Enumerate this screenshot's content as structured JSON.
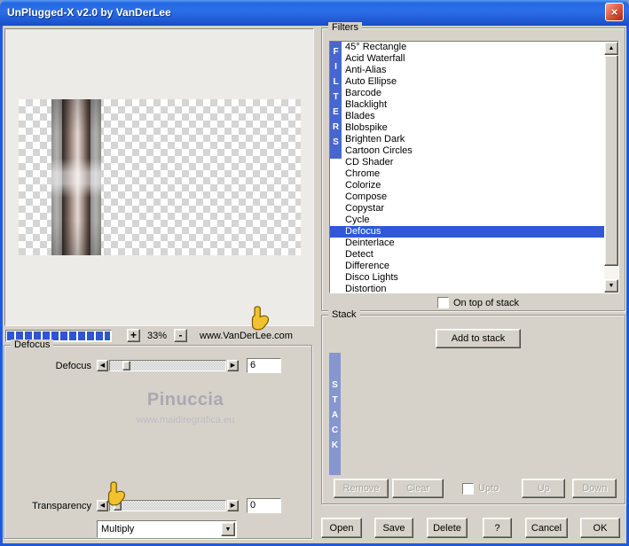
{
  "window": {
    "title": "UnPlugged-X v2.0 by VanDerLee"
  },
  "icons": {
    "close": "×",
    "arrow_up": "▲",
    "arrow_down": "▼",
    "arrow_left": "◀",
    "arrow_right": "▶",
    "combo_arrow": "▼"
  },
  "preview": {
    "zoom_in": "+",
    "zoom_level": "33%",
    "zoom_out": "-",
    "website": "www.VanDerLee.com"
  },
  "defocus": {
    "group_title": "Defocus",
    "slider_label": "Defocus",
    "slider_value": "6",
    "watermark_name": "Pinuccia",
    "watermark_site": "www.maidiregrafica.eu",
    "transparency_label": "Transparency",
    "transparency_value": "0",
    "blend_mode": "Multiply"
  },
  "filters": {
    "group_title": "Filters",
    "vertical_label": "FILTERS",
    "on_top_label": "On top of stack",
    "items": [
      {
        "label": "45° Rectangle"
      },
      {
        "label": "Acid Waterfall"
      },
      {
        "label": "Anti-Alias"
      },
      {
        "label": "Auto Ellipse"
      },
      {
        "label": "Barcode"
      },
      {
        "label": "Blacklight"
      },
      {
        "label": "Blades"
      },
      {
        "label": "Blobspike"
      },
      {
        "label": "Brighten Dark"
      },
      {
        "label": "Cartoon Circles"
      },
      {
        "label": "CD Shader"
      },
      {
        "label": "Chrome"
      },
      {
        "label": "Colorize"
      },
      {
        "label": "Compose"
      },
      {
        "label": "Copystar"
      },
      {
        "label": "Cycle"
      },
      {
        "label": "Defocus",
        "selected": true
      },
      {
        "label": "Deinterlace"
      },
      {
        "label": "Detect"
      },
      {
        "label": "Difference"
      },
      {
        "label": "Disco Lights"
      },
      {
        "label": "Distortion"
      }
    ]
  },
  "stack": {
    "group_title": "Stack",
    "add_button": "Add to stack",
    "vertical_label": "STACK",
    "remove_button": "Remove",
    "clear_button": "Clear",
    "upto_label": "Upto",
    "up_button": "Up",
    "down_button": "Down"
  },
  "footer": {
    "open": "Open",
    "save": "Save",
    "delete": "Delete",
    "help": "?",
    "cancel": "Cancel",
    "ok": "OK"
  },
  "colors": {
    "selection": "#2e58d8",
    "filters_strip": "#4468cf",
    "stack_strip": "#8696cf",
    "progress": "#2f55cf",
    "titlebar": "#1b5cd8",
    "close_button": "#c33a1e"
  }
}
